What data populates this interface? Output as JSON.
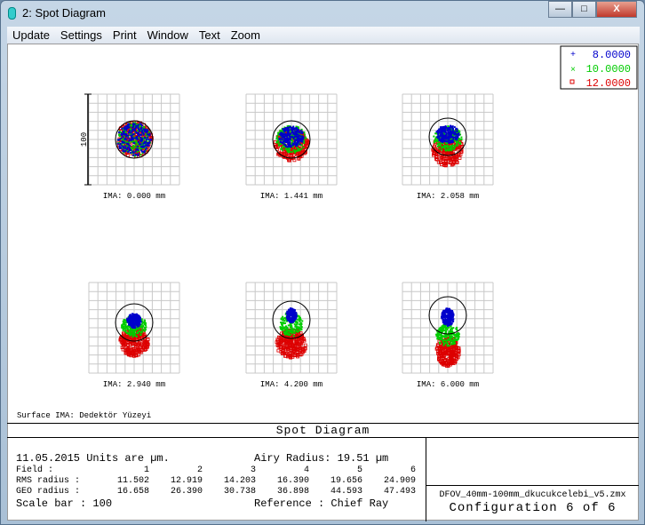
{
  "window": {
    "title": "2: Spot Diagram",
    "buttons": [
      "minimize",
      "maximize",
      "close"
    ]
  },
  "menu": [
    "Update",
    "Settings",
    "Print",
    "Window",
    "Text",
    "Zoom"
  ],
  "legend": [
    {
      "label": "8.0000",
      "color": "#0000cc",
      "marker": "+"
    },
    {
      "label": "10.0000",
      "color": "#00cc00",
      "marker": "×"
    },
    {
      "label": "12.0000",
      "color": "#dd0000",
      "marker": "□"
    }
  ],
  "scale_label": "100",
  "panels": [
    {
      "label": "IMA: 0.000 mm"
    },
    {
      "label": "IMA: 1.441 mm"
    },
    {
      "label": "IMA: 2.058 mm"
    },
    {
      "label": "IMA: 2.940 mm"
    },
    {
      "label": "IMA: 4.200 mm"
    },
    {
      "label": "IMA: 6.000 mm"
    }
  ],
  "surface": "Surface IMA: Dedektör Yüzeyi",
  "info": {
    "title": "Spot Diagram",
    "date_units": "11.05.2015  Units are µm.",
    "airy": "Airy Radius: 19.51 µm",
    "field": {
      "label": "Field     :",
      "values": [
        "1",
        "2",
        "3",
        "4",
        "5",
        "6"
      ]
    },
    "rms": {
      "label": "RMS radius :",
      "values": [
        "11.502",
        "12.919",
        "14.203",
        "16.390",
        "19.656",
        "24.909"
      ]
    },
    "geo": {
      "label": "GEO radius :",
      "values": [
        "16.658",
        "26.390",
        "30.738",
        "36.898",
        "44.593",
        "47.493"
      ]
    },
    "scale_bar": "Scale bar  : 100",
    "reference": "Reference  : Chief Ray",
    "file": "DFOV_40mm-100mm_dkucukcelebi_v5.zmx",
    "configuration": "Configuration 6 of 6"
  }
}
